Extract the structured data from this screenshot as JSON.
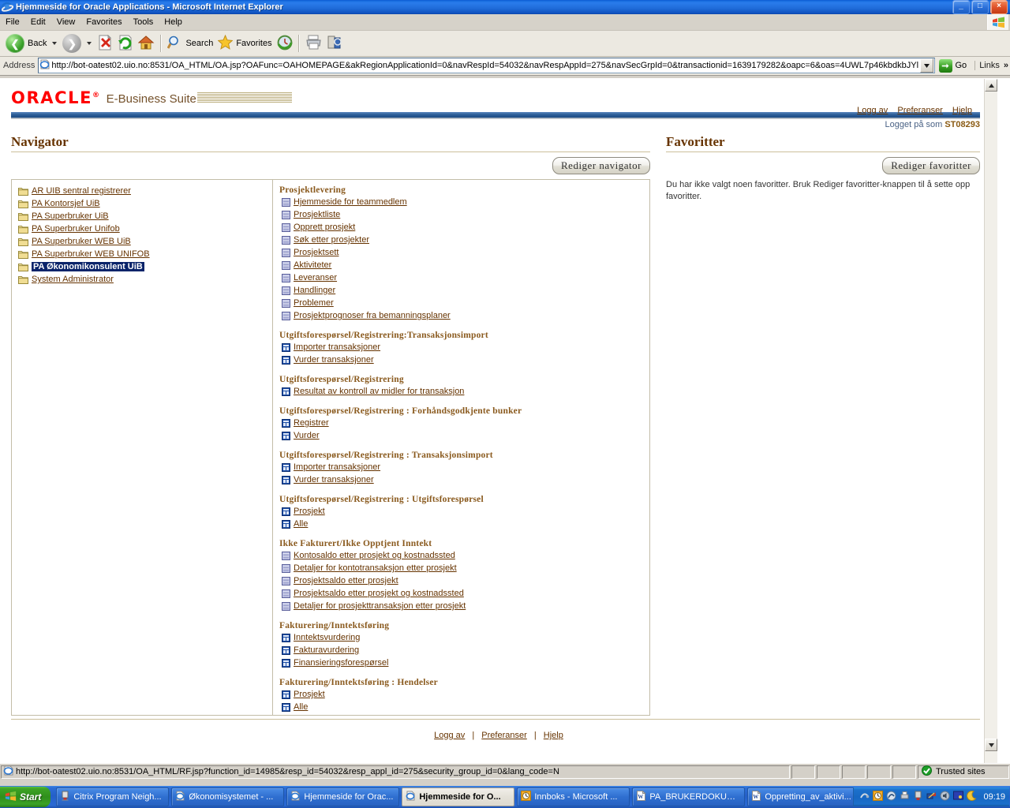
{
  "window": {
    "title": "Hjemmeside for Oracle Applications - Microsoft Internet Explorer",
    "minimize": "_",
    "maximize": "□",
    "close": "×"
  },
  "menu": [
    "File",
    "Edit",
    "View",
    "Favorites",
    "Tools",
    "Help"
  ],
  "toolbar": {
    "back": "Back",
    "search": "Search",
    "favorites": "Favorites"
  },
  "address": {
    "label": "Address",
    "url": "http://bot-oatest02.uio.no:8531/OA_HTML/OA.jsp?OAFunc=OAHOMEPAGE&akRegionApplicationId=0&navRespId=54032&navRespAppId=275&navSecGrpId=0&transactionid=1639179282&oapc=6&oas=4UWL7p46kbdkbJYl",
    "go": "Go",
    "links": "Links",
    "links_chevron": "»"
  },
  "branding": {
    "oracle": "ORACLE",
    "registered": "®",
    "suite": "E-Business Suite"
  },
  "header_links": [
    {
      "label": "Logg av"
    },
    {
      "label": "Preferanser"
    },
    {
      "label": "Hjelp"
    }
  ],
  "logged_in": {
    "prefix": "Logget på som ",
    "user": "ST08293"
  },
  "navigator": {
    "title": "Navigator",
    "edit_button": "Rediger navigator",
    "responsibilities": [
      {
        "label": "AR UIB sentral registrerer",
        "selected": false
      },
      {
        "label": "PA Kontorsjef UiB",
        "selected": false
      },
      {
        "label": "PA Superbruker UiB",
        "selected": false
      },
      {
        "label": "PA Superbruker Unifob",
        "selected": false
      },
      {
        "label": "PA Superbruker WEB UiB",
        "selected": false
      },
      {
        "label": "PA Superbruker WEB UNIFOB",
        "selected": false
      },
      {
        "label": "PA Økonomikonsulent UiB",
        "selected": true
      },
      {
        "label": "System Administrator",
        "selected": false
      }
    ],
    "groups": [
      {
        "title": "Prosjektlevering",
        "icon": "page-icon",
        "items": [
          "Hjemmeside for teammedlem",
          "Prosjektliste",
          "Opprett prosjekt",
          "Søk etter prosjekter",
          "Prosjektsett",
          "Aktiviteter",
          "Leveranser",
          "Handlinger",
          "Problemer",
          "Prosjektprognoser fra bemanningsplaner"
        ]
      },
      {
        "title": "Utgiftsforespørsel/Registrering:Transaksjonsimport",
        "icon": "form-icon",
        "items": [
          "Importer transaksjoner",
          "Vurder transaksjoner"
        ]
      },
      {
        "title": "Utgiftsforespørsel/Registrering",
        "icon": "form-icon",
        "items": [
          "Resultat av kontroll av midler for transaksjon"
        ]
      },
      {
        "title": "Utgiftsforespørsel/Registrering : Forhåndsgodkjente bunker",
        "icon": "form-icon",
        "items": [
          "Registrer",
          "Vurder"
        ]
      },
      {
        "title": "Utgiftsforespørsel/Registrering : Transaksjonsimport",
        "icon": "form-icon",
        "items": [
          "Importer transaksjoner",
          "Vurder transaksjoner"
        ]
      },
      {
        "title": "Utgiftsforespørsel/Registrering : Utgiftsforespørsel",
        "icon": "form-icon",
        "items": [
          "Prosjekt",
          "Alle"
        ]
      },
      {
        "title": "Ikke Fakturert/Ikke Opptjent Inntekt",
        "icon": "page-icon",
        "items": [
          "Kontosaldo etter prosjekt og kostnadssted",
          "Detaljer for kontotransaksjon etter prosjekt",
          "Prosjektsaldo etter prosjekt",
          "Prosjektsaldo etter prosjekt og kostnadssted",
          "Detaljer for prosjekttransaksjon etter prosjekt"
        ]
      },
      {
        "title": "Fakturering/Inntektsføring",
        "icon": "form-icon",
        "items": [
          "Inntektsvurdering",
          "Fakturavurdering",
          "Finansieringsforespørsel"
        ]
      },
      {
        "title": "Fakturering/Inntektsføring : Hendelser",
        "icon": "form-icon",
        "items": [
          "Prosjekt",
          "Alle"
        ]
      }
    ]
  },
  "favorites": {
    "title": "Favoritter",
    "edit_button": "Rediger favoritter",
    "empty_message": "Du har ikke valgt noen favoritter. Bruk Rediger favoritter-knappen til å sette opp favoritter."
  },
  "footer_links": [
    {
      "label": "Logg av"
    },
    {
      "label": "Preferanser"
    },
    {
      "label": "Hjelp"
    }
  ],
  "footer_separator": "|",
  "statusbar": {
    "url": "http://bot-oatest02.uio.no:8531/OA_HTML/RF.jsp?function_id=14985&resp_id=54032&resp_appl_id=275&security_group_id=0&lang_code=N",
    "zone": "Trusted sites"
  },
  "taskbar": {
    "start": "Start",
    "tasks": [
      {
        "label": "Citrix Program Neigh...",
        "icon": "citrix-icon",
        "active": false
      },
      {
        "label": "Økonomisystemet - ...",
        "icon": "ie-icon",
        "active": false
      },
      {
        "label": "Hjemmeside for Orac...",
        "icon": "ie-icon",
        "active": false
      },
      {
        "label": "Hjemmeside for O...",
        "icon": "ie-icon",
        "active": true
      },
      {
        "label": "Innboks - Microsoft ...",
        "icon": "outlook-icon",
        "active": false
      },
      {
        "label": "PA_BRUKERDOKUME...",
        "icon": "word-icon",
        "active": false
      },
      {
        "label": "Oppretting_av_aktivi...",
        "icon": "word-icon",
        "active": false
      }
    ],
    "clock": "09:19"
  },
  "colors": {
    "accent_blue": "#2e5f99",
    "oracle_red": "#ff0000",
    "link_brown": "#663300",
    "heading_brown": "#8a5a1e",
    "selection_blue": "#0a246a"
  }
}
